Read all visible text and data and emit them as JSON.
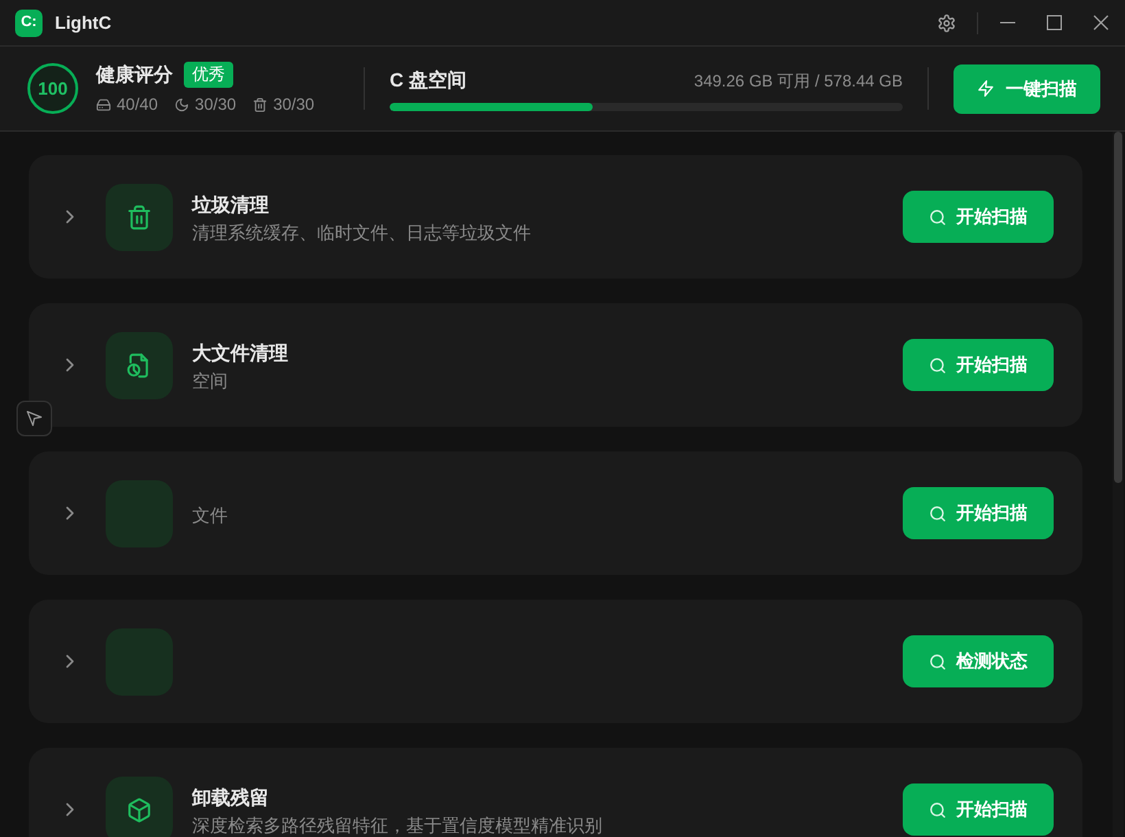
{
  "window": {
    "logo": "C:",
    "title": "LightC"
  },
  "health": {
    "score": "100",
    "label": "健康评分",
    "badge": "优秀",
    "stats": [
      {
        "value": "40/40"
      },
      {
        "value": "30/30"
      },
      {
        "value": "30/30"
      }
    ]
  },
  "disk": {
    "label": "C 盘空间",
    "reading": "349.26 GB 可用 / 578.44 GB",
    "level": 0.396
  },
  "scan_all_button": "一键扫描",
  "cards": [
    {
      "title": "垃圾清理",
      "description": "清理系统缓存、临时文件、日志等垃圾文件",
      "button": "开始扫描"
    },
    {
      "title": "大文件清理",
      "description": "空间",
      "button": "开始扫描"
    },
    {
      "description": "文件",
      "button": "开始扫描"
    },
    {
      "button": "检测状态"
    },
    {
      "title": "卸载残留",
      "description": "深度检索多路径残留特征，基于置信度模型精准识别",
      "button": "开始扫描"
    }
  ]
}
